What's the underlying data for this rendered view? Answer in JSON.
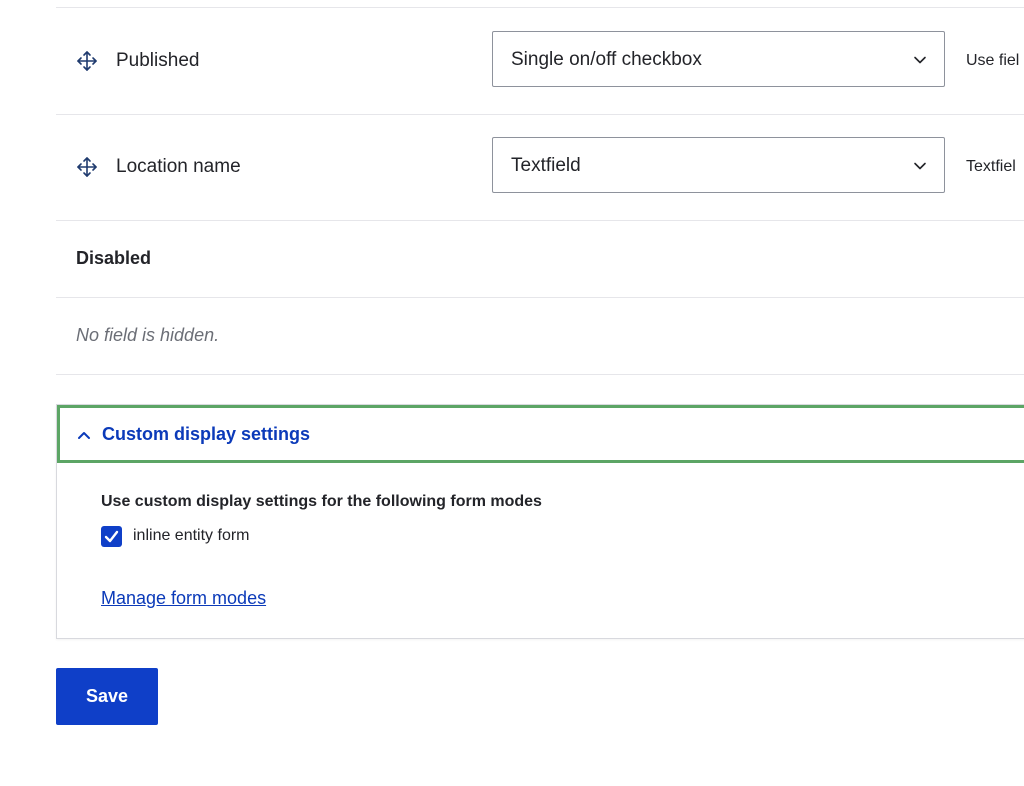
{
  "enabled_fields": [
    {
      "label": "Published",
      "widget": "Single on/off checkbox",
      "summary": "Use fiel"
    },
    {
      "label": "Location name",
      "widget": "Textfield",
      "summary": "Textfiel"
    }
  ],
  "disabled_section": {
    "heading": "Disabled",
    "empty_message": "No field is hidden."
  },
  "custom_display": {
    "summary": "Custom display settings",
    "expanded": true,
    "fieldset_title": "Use custom display settings for the following form modes",
    "checkbox_label": "inline entity form",
    "checkbox_checked": true,
    "manage_link": "Manage form modes"
  },
  "actions": {
    "save_label": "Save"
  },
  "icons": {
    "drag": "move-arrows-icon",
    "select_chevron": "chevron-down-icon",
    "summary_chevron": "chevron-up-icon",
    "checkmark": "checkmark-icon"
  },
  "colors": {
    "primary": "#0f3fc8",
    "link": "#0b3ab9",
    "focus_outline": "#5ca565",
    "border": "#e6e6ea",
    "muted_text": "#6b6e76"
  }
}
